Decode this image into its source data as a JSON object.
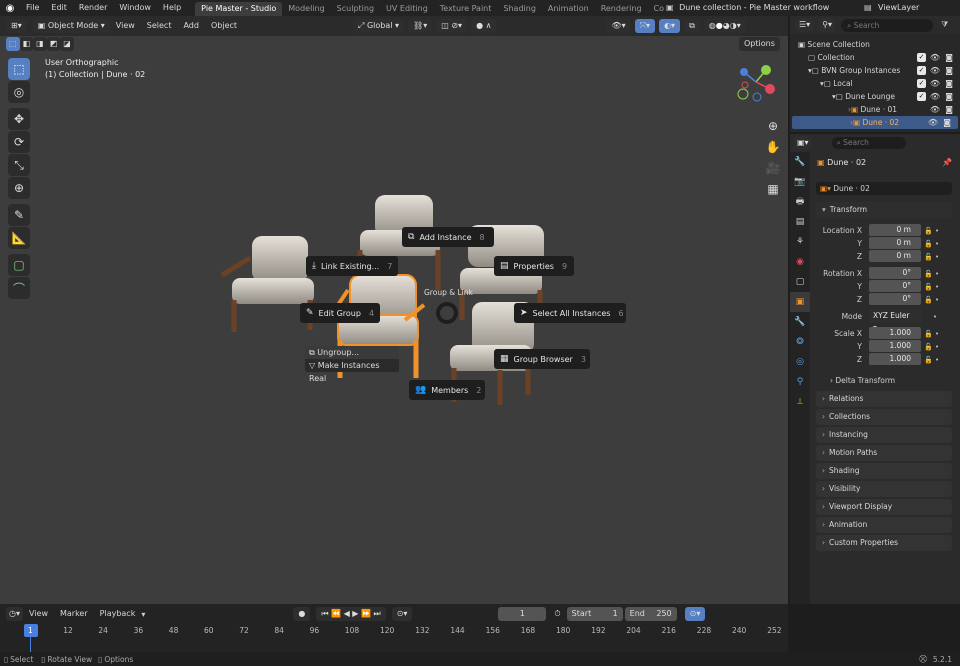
{
  "topbar": {
    "menus": [
      "File",
      "Edit",
      "Render",
      "Window",
      "Help"
    ],
    "workspaces": [
      "Pie Master - Studio",
      "Modeling",
      "Sculpting",
      "UV Editing",
      "Texture Paint",
      "Shading",
      "Animation",
      "Rendering",
      "Composi"
    ],
    "scene": "Dune collection - Pie Master workflow",
    "view_layer": "ViewLayer"
  },
  "viewport_header": {
    "mode": "Object Mode",
    "menus": [
      "View",
      "Select",
      "Add",
      "Object"
    ],
    "orientation": "Global",
    "options": "Options"
  },
  "viewport": {
    "view_name": "User Orthographic",
    "collection_info": "(1) Collection | Dune · 02"
  },
  "pie_menu": {
    "title": "Group & Link",
    "items": [
      {
        "label": "Add Instance",
        "num": "8",
        "icon": "⧉"
      },
      {
        "label": "Link Existing...",
        "num": "7",
        "icon": "⤓"
      },
      {
        "label": "Properties",
        "num": "9",
        "icon": "▤"
      },
      {
        "label": "Edit Group",
        "num": "4",
        "icon": "✎"
      },
      {
        "label": "Select All Instances",
        "num": "6",
        "icon": "➤"
      },
      {
        "label": "Group Browser",
        "num": "3",
        "icon": "▦"
      },
      {
        "label": "Members",
        "num": "2",
        "icon": "👥"
      }
    ],
    "submenu": [
      "Ungroup...",
      "Make Instances Real"
    ]
  },
  "outliner": {
    "search_placeholder": "Search",
    "rows": [
      {
        "label": "Scene Collection",
        "indent": 0
      },
      {
        "label": "Collection",
        "indent": 1
      },
      {
        "label": "BVN Group Instances",
        "indent": 1
      },
      {
        "label": "Local",
        "indent": 2
      },
      {
        "label": "Dune Lounge",
        "indent": 3
      },
      {
        "label": "Dune · 01",
        "indent": 4
      },
      {
        "label": "Dune · 02",
        "indent": 4
      }
    ]
  },
  "properties": {
    "search_placeholder": "Search",
    "object_name": "Dune · 02",
    "data_name": "Dune · 02",
    "transform_label": "Transform",
    "location_label": "Location X",
    "rotation_label": "Rotation X",
    "mode_label": "Mode",
    "mode_value": "XYZ Euler",
    "scale_label": "Scale X",
    "y_label": "Y",
    "z_label": "Z",
    "location": [
      "0 m",
      "0 m",
      "0 m"
    ],
    "rotation": [
      "0°",
      "0°",
      "0°"
    ],
    "scale": [
      "1.000",
      "1.000",
      "1.000"
    ],
    "delta": "Delta Transform",
    "panels": [
      "Relations",
      "Collections",
      "Instancing",
      "Motion Paths",
      "Shading",
      "Visibility",
      "Viewport Display",
      "Animation",
      "Custom Properties"
    ]
  },
  "timeline": {
    "menus": [
      "View",
      "Marker",
      "Playback"
    ],
    "current_frame": "1",
    "start_label": "Start",
    "start": "1",
    "end_label": "End",
    "end": "250",
    "ticks": [
      "1",
      "12",
      "24",
      "36",
      "48",
      "60",
      "72",
      "84",
      "96",
      "108",
      "120",
      "132",
      "144",
      "156",
      "168",
      "180",
      "192",
      "204",
      "216",
      "228",
      "240",
      "252"
    ]
  },
  "status": {
    "items": [
      "Select",
      "Rotate View",
      "Options"
    ],
    "version": "5.2.1"
  },
  "colors": {
    "accent": "#5680c2",
    "selection_orange": "#f0922a",
    "viewport_bg": "#3d3d3d"
  }
}
